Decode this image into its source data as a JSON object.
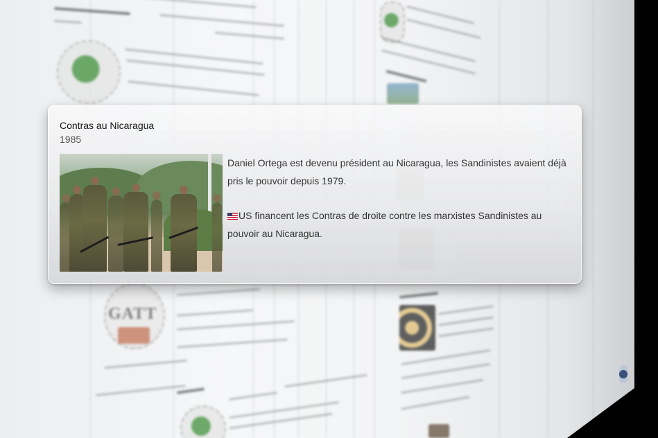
{
  "event": {
    "title": "Contras au Nicaragua",
    "date": "1985",
    "photo_icon": "soldiers-photo",
    "paragraph1": "Daniel Ortega est devenu président au Nicaragua, les Sandinistes avaient déjà pris le pouvoir depuis 1979.",
    "paragraph2_flag_icon": "us-flag-icon",
    "paragraph2_country": "US",
    "paragraph2_rest": " financent les Contras de droite contre les marxistes Sandinistes au pouvoir au Nicaragua."
  },
  "background": {
    "logo_text": "GATT"
  },
  "colors": {
    "card_background": "#e9eaec",
    "title_text": "#151515",
    "date_text": "#555555",
    "body_text": "#333333"
  }
}
